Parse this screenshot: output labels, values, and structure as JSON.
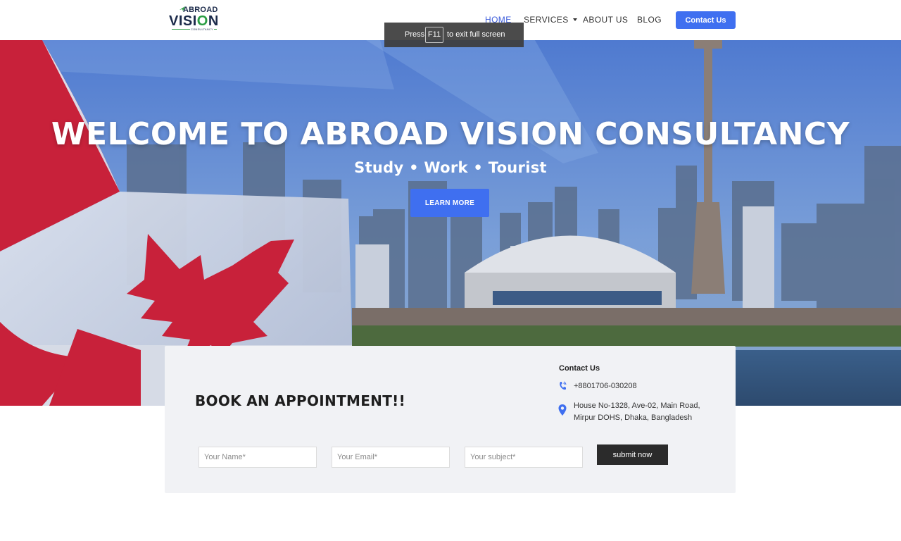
{
  "colors": {
    "accent": "#3f6ff0",
    "nav_active": "#3b5bdb",
    "card_bg": "#f1f2f5",
    "submit_bg": "#2b2b2b",
    "flag_red": "#c8213a"
  },
  "logo": {
    "top": "ABROAD",
    "main_left": "VISI",
    "main_o": "O",
    "main_right": "N",
    "sub": "CONSULTANCY"
  },
  "nav": {
    "items": [
      {
        "label": "HOME",
        "active": true
      },
      {
        "label": "SERVICES",
        "has_dropdown": true
      },
      {
        "label": "ABOUT US"
      },
      {
        "label": "BLOG"
      }
    ],
    "cta": "Contact Us"
  },
  "fullscreen_toast": {
    "before": "Press",
    "key": "F11",
    "after": "to exit full screen"
  },
  "hero": {
    "title": "WELCOME TO ABROAD VISION CONSULTANCY",
    "subtitle": "Study • Work • Tourist",
    "button": "LEARN MORE"
  },
  "appointment": {
    "title": "BOOK AN APPOINTMENT!!",
    "contact_heading": "Contact Us",
    "phone": "+8801706-030208",
    "address_line1": "House No-1328, Ave-02, Main Road,",
    "address_line2": "Mirpur DOHS, Dhaka, Bangladesh",
    "name_placeholder": "Your Name*",
    "email_placeholder": "Your Email*",
    "subject_placeholder": "Your subject*",
    "submit": "submit now"
  },
  "icons": [
    "plane-icon",
    "caret-down-icon",
    "phone-icon",
    "location-pin-icon"
  ]
}
